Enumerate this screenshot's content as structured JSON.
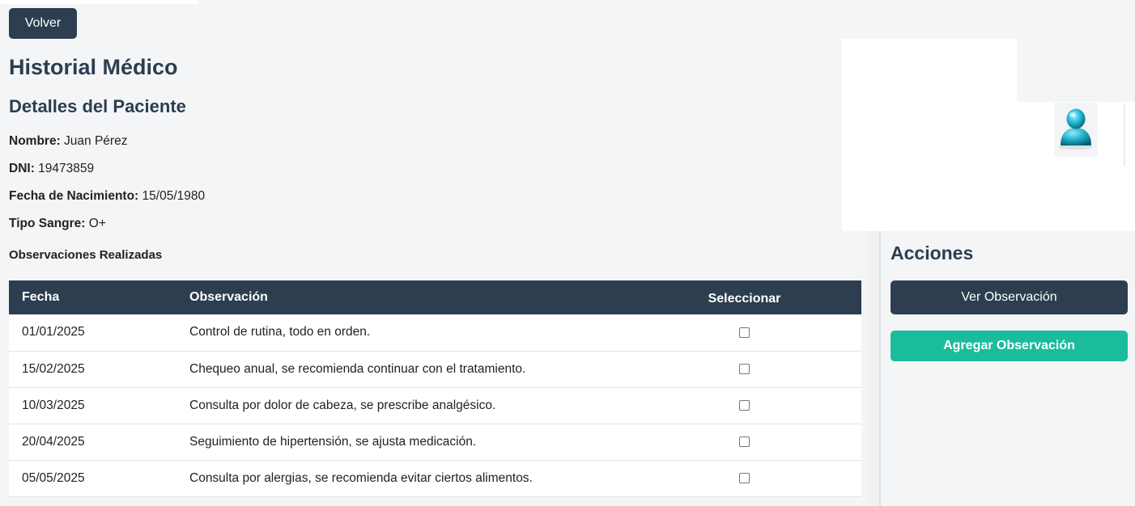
{
  "nav": {
    "back_label": "Volver"
  },
  "page": {
    "title": "Historial Médico",
    "subtitle": "Detalles del Paciente"
  },
  "patient": {
    "name_label": "Nombre:",
    "name": "Juan Pérez",
    "dni_label": "DNI:",
    "dni": "19473859",
    "birth_label": "Fecha de Nacimiento:",
    "birth": "15/05/1980",
    "blood_label": "Tipo Sangre:",
    "blood": "O+"
  },
  "observations": {
    "title": "Observaciones Realizadas",
    "headers": [
      "Fecha",
      "Observación",
      "Seleccionar"
    ],
    "rows": [
      {
        "date": "01/01/2025",
        "text": "Control de rutina, todo en orden.",
        "selected": false
      },
      {
        "date": "15/02/2025",
        "text": "Chequeo anual, se recomienda continuar con el tratamiento.",
        "selected": false
      },
      {
        "date": "10/03/2025",
        "text": "Consulta por dolor de cabeza, se prescribe analgésico.",
        "selected": false
      },
      {
        "date": "20/04/2025",
        "text": "Seguimiento de hipertensión, se ajusta medicación.",
        "selected": false
      },
      {
        "date": "05/05/2025",
        "text": "Consulta por alergias, se recomienda evitar ciertos alimentos.",
        "selected": false
      }
    ]
  },
  "sidebar": {
    "avatar_icon": "user-avatar-icon",
    "actions_title": "Acciones",
    "view_label": "Ver Observación",
    "add_label": "Agregar Observación"
  },
  "colors": {
    "primary": "#2c3e50",
    "accent": "#1abc9c",
    "background": "#f4f5f7"
  }
}
